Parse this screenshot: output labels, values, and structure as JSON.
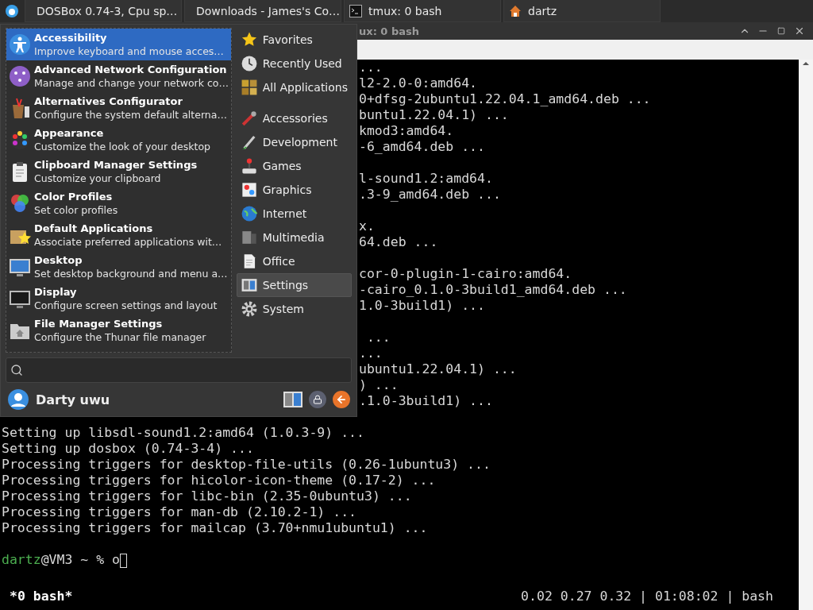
{
  "taskbar": {
    "tasks": [
      {
        "label": "DOSBox 0.74-3, Cpu sp…",
        "kind": "dosbox"
      },
      {
        "label": "Downloads - James's Co…",
        "kind": "browser"
      },
      {
        "label": "tmux: 0 bash",
        "kind": "terminal"
      },
      {
        "label": "dartz",
        "kind": "folder"
      }
    ]
  },
  "terminal_window": {
    "title": "ux: 0 bash",
    "lines": [
      {
        "kind": "fragment",
        "text": "..."
      },
      {
        "kind": "fragment",
        "text": "l2-2.0-0:amd64."
      },
      {
        "kind": "fragment",
        "text": "0+dfsg-2ubuntu1.22.04.1_amd64.deb ..."
      },
      {
        "kind": "fragment",
        "text": "buntu1.22.04.1) ..."
      },
      {
        "kind": "fragment",
        "text": "kmod3:amd64."
      },
      {
        "kind": "fragment",
        "text": "-6_amd64.deb ..."
      },
      {
        "kind": "blank"
      },
      {
        "kind": "fragment",
        "text": "l-sound1.2:amd64."
      },
      {
        "kind": "fragment",
        "text": ".3-9_amd64.deb ..."
      },
      {
        "kind": "blank"
      },
      {
        "kind": "fragment",
        "text": "x."
      },
      {
        "kind": "fragment",
        "text": "64.deb ..."
      },
      {
        "kind": "blank"
      },
      {
        "kind": "fragment",
        "text": "cor-0-plugin-1-cairo:amd64."
      },
      {
        "kind": "fragment",
        "text": "-cairo_0.1.0-3build1_amd64.deb ..."
      },
      {
        "kind": "fragment",
        "text": "1.0-3build1) ..."
      },
      {
        "kind": "blank"
      },
      {
        "kind": "fragment",
        "text": " ..."
      },
      {
        "kind": "fragment",
        "text": "..."
      },
      {
        "kind": "fragment",
        "text": "ubuntu1.22.04.1) ..."
      },
      {
        "kind": "fragment",
        "text": ") ..."
      },
      {
        "kind": "fragment",
        "text": ".1.0-3build1) ..."
      },
      {
        "kind": "blank"
      },
      {
        "kind": "line",
        "text": "Setting up libsdl-sound1.2:amd64 (1.0.3-9) ..."
      },
      {
        "kind": "line",
        "text": "Setting up dosbox (0.74-3-4) ..."
      },
      {
        "kind": "line",
        "text": "Processing triggers for desktop-file-utils (0.26-1ubuntu3) ..."
      },
      {
        "kind": "line",
        "text": "Processing triggers for hicolor-icon-theme (0.17-2) ..."
      },
      {
        "kind": "line",
        "text": "Processing triggers for libc-bin (2.35-0ubuntu3) ..."
      },
      {
        "kind": "line",
        "text": "Processing triggers for man-db (2.10.2-1) ..."
      },
      {
        "kind": "line",
        "text": "Processing triggers for mailcap (3.70+nmu1ubuntu1) ..."
      },
      {
        "kind": "blank"
      }
    ],
    "prompt": {
      "user": "dartz",
      "rest": "@VM3 ~ % o"
    },
    "status_bar": {
      "left": "*0 bash*",
      "right": "0.02 0.27 0.32 | 01:08:02 | bash"
    }
  },
  "menu": {
    "apps": [
      {
        "name": "Accessibility",
        "description": "Improve keyboard and mouse acces…",
        "selected": true
      },
      {
        "name": "Advanced Network Configuration",
        "description": "Manage and change your network co…",
        "selected": false
      },
      {
        "name": "Alternatives Configurator",
        "description": "Configure the system default alterna…",
        "selected": false
      },
      {
        "name": "Appearance",
        "description": "Customize the look of your desktop",
        "selected": false
      },
      {
        "name": "Clipboard Manager Settings",
        "description": "Customize your clipboard",
        "selected": false
      },
      {
        "name": "Color Profiles",
        "description": "Set color profiles",
        "selected": false
      },
      {
        "name": "Default Applications",
        "description": "Associate preferred applications wit…",
        "selected": false
      },
      {
        "name": "Desktop",
        "description": "Set desktop background and menu a…",
        "selected": false
      },
      {
        "name": "Display",
        "description": "Configure screen settings and layout",
        "selected": false
      },
      {
        "name": "File Manager Settings",
        "description": "Configure the Thunar file manager",
        "selected": false
      }
    ],
    "places": [
      {
        "label": "Favorites",
        "selected": false
      },
      {
        "label": "Recently Used",
        "selected": false
      },
      {
        "label": "All Applications",
        "selected": false
      }
    ],
    "categories": [
      {
        "label": "Accessories",
        "selected": false
      },
      {
        "label": "Development",
        "selected": false
      },
      {
        "label": "Games",
        "selected": false
      },
      {
        "label": "Graphics",
        "selected": false
      },
      {
        "label": "Internet",
        "selected": false
      },
      {
        "label": "Multimedia",
        "selected": false
      },
      {
        "label": "Office",
        "selected": false
      },
      {
        "label": "Settings",
        "selected": true
      },
      {
        "label": "System",
        "selected": false
      }
    ],
    "user": {
      "name": "Darty uwu"
    }
  }
}
